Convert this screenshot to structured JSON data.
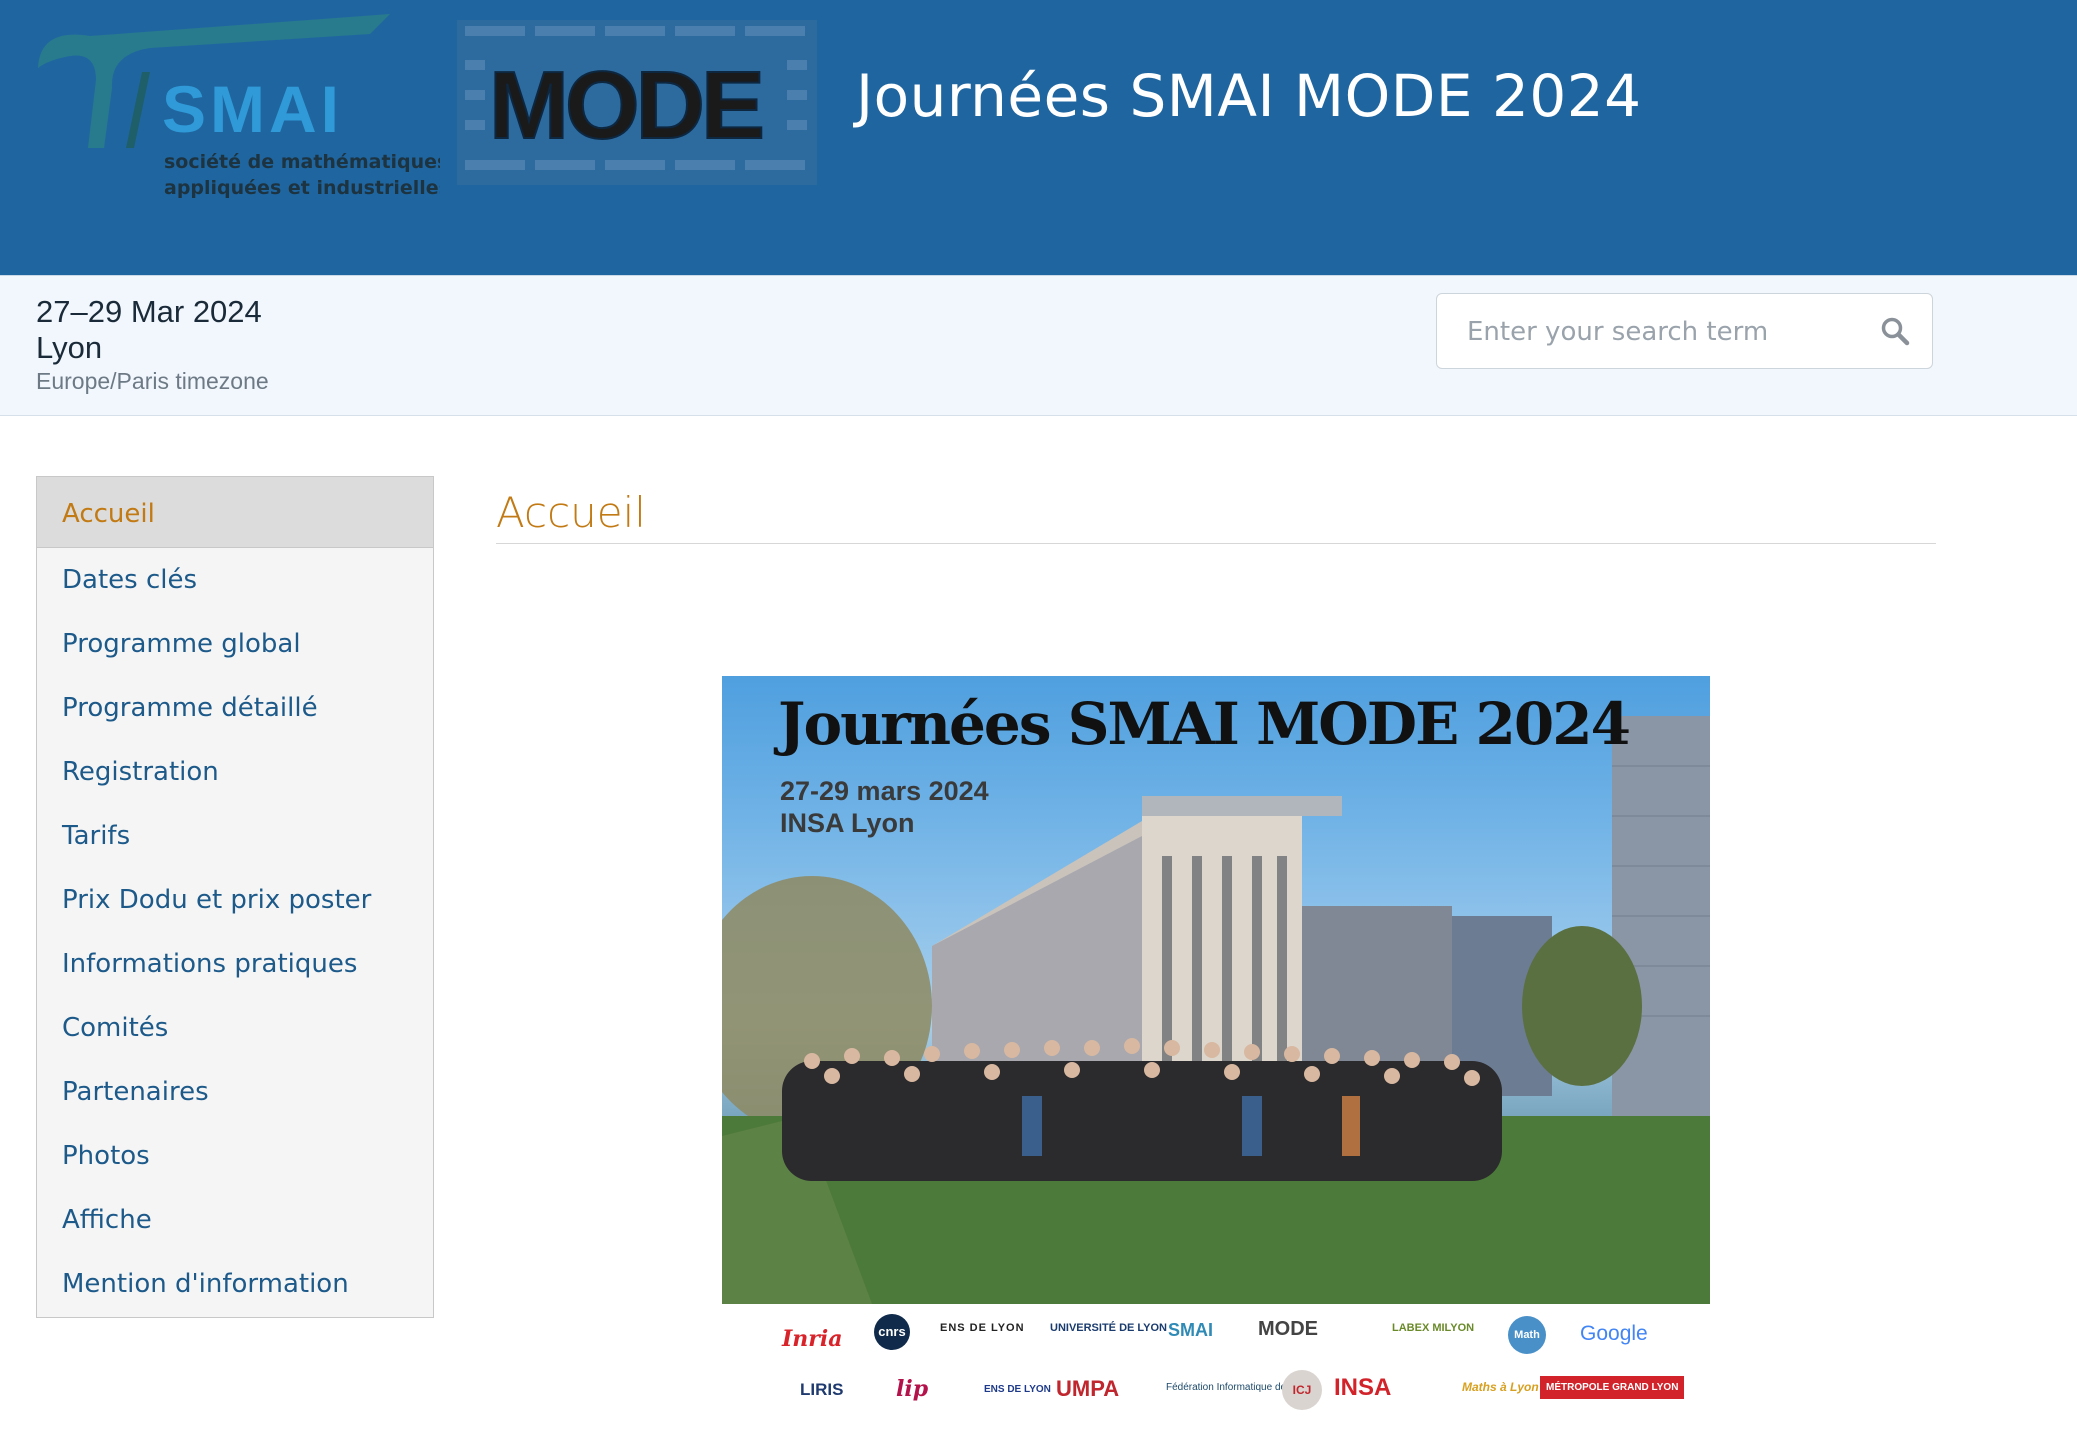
{
  "header": {
    "title": "Journées SMAI MODE 2024",
    "smai_logo_text": "SMAI",
    "smai_logo_caption_1": "société de mathématiques",
    "smai_logo_caption_2": "appliquées et industrielles",
    "mode_logo_text": "MODE"
  },
  "event": {
    "dates": "27–29 Mar 2024",
    "city": "Lyon",
    "timezone": "Europe/Paris timezone"
  },
  "search": {
    "placeholder": "Enter your search term"
  },
  "sidebar": {
    "items": [
      {
        "label": "Accueil",
        "active": true
      },
      {
        "label": "Dates clés"
      },
      {
        "label": "Programme global"
      },
      {
        "label": "Programme détaillé"
      },
      {
        "label": "Registration"
      },
      {
        "label": "Tarifs"
      },
      {
        "label": "Prix Dodu et prix poster"
      },
      {
        "label": "Informations pratiques"
      },
      {
        "label": "Comités"
      },
      {
        "label": "Partenaires"
      },
      {
        "label": "Photos"
      },
      {
        "label": "Affiche"
      },
      {
        "label": "Mention d'information"
      }
    ]
  },
  "main": {
    "title": "Accueil",
    "poster": {
      "title": "Journées SMAI MODE 2024",
      "dates": "27-29 mars 2024",
      "venue": "INSA Lyon"
    },
    "partner_logos_row1": [
      "Inria",
      "cnrs",
      "ENS DE LYON",
      "UNIVERSITÉ DE LYON",
      "SMAI",
      "MODE",
      "LABEX MILYON",
      "Math",
      "Google"
    ],
    "partner_logos_row2": [
      "LIRIS",
      "lip",
      "ENS DE LYON",
      "UMPA",
      "Fédération Informatique de Lyon",
      "ICJ",
      "INSA",
      "Maths à Lyon",
      "MÉTROPOLE GRAND LYON"
    ]
  },
  "colors": {
    "header_bg": "#1f66a0",
    "accent": "#c27a14",
    "link": "#1d5a8a"
  }
}
